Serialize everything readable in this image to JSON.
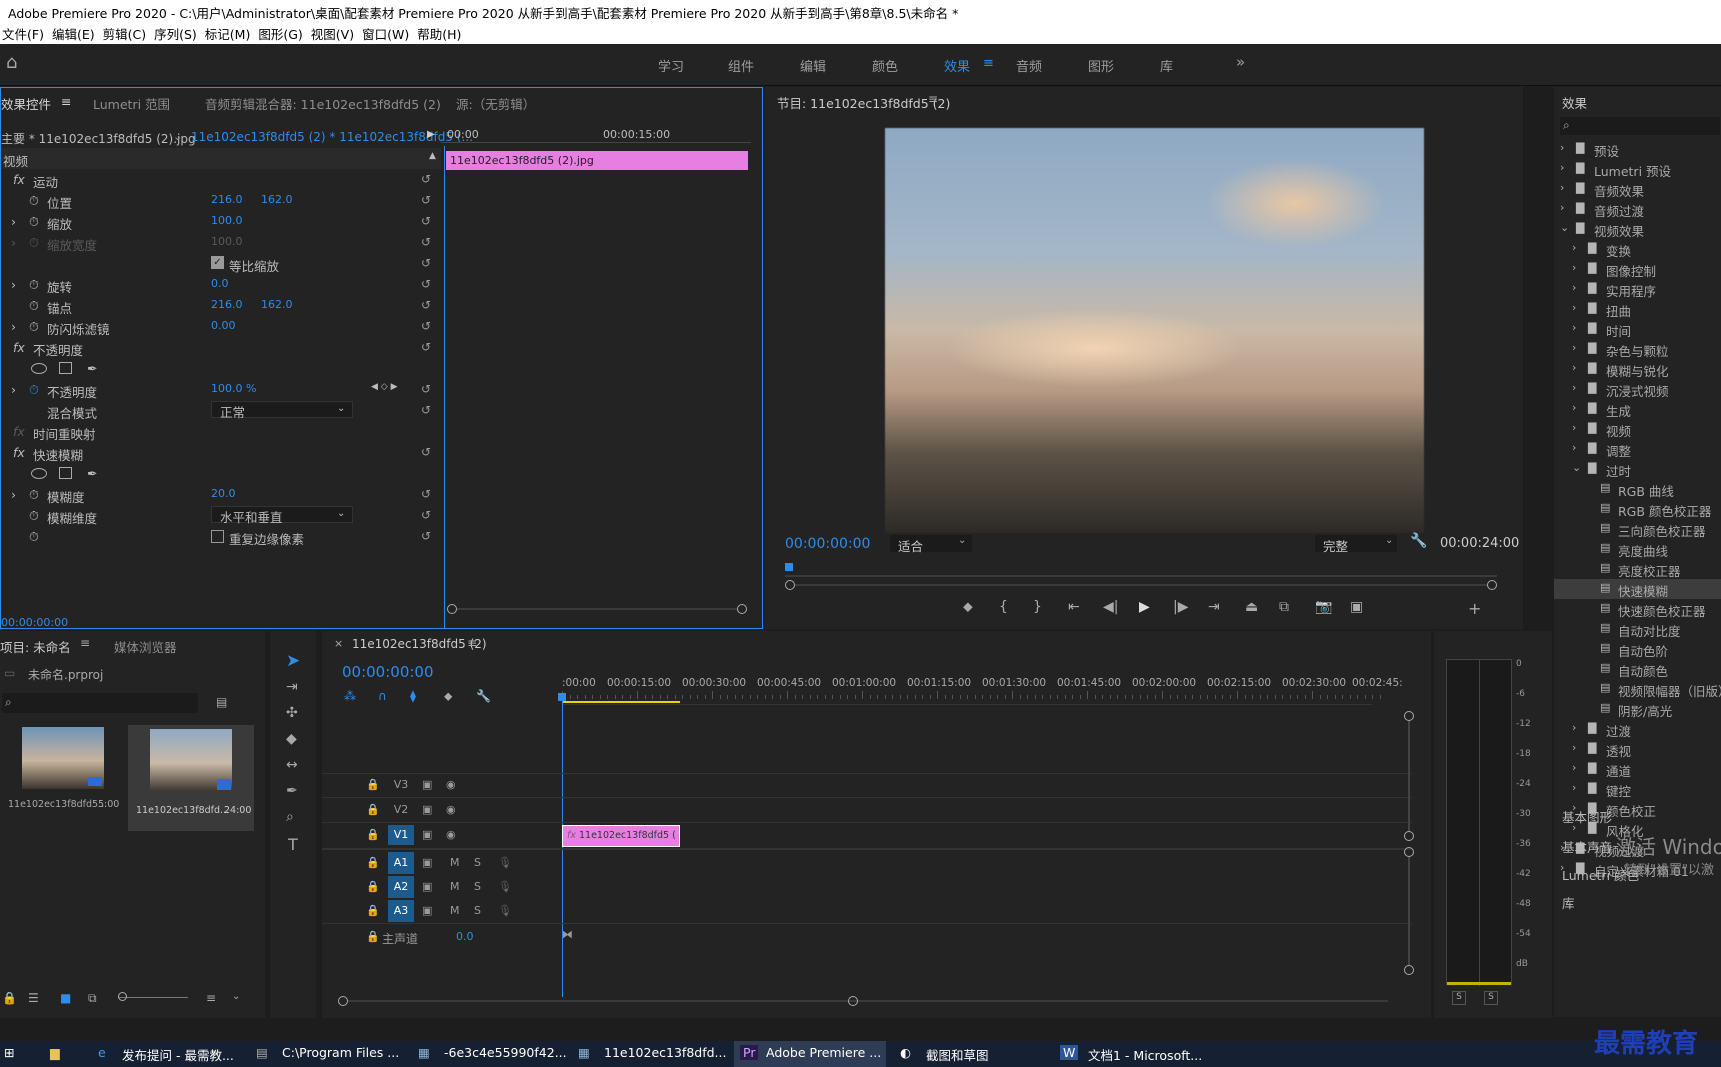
{
  "window": {
    "title": "Adobe Premiere Pro 2020 - C:\\用户\\Administrator\\桌面\\配套素材 Premiere Pro 2020 从新手到高手\\配套素材 Premiere Pro 2020 从新手到高手\\第8章\\8.5\\未命名 *"
  },
  "menu": [
    "文件(F)",
    "编辑(E)",
    "剪辑(C)",
    "序列(S)",
    "标记(M)",
    "图形(G)",
    "视图(V)",
    "窗口(W)",
    "帮助(H)"
  ],
  "workspaces": {
    "items": [
      "学习",
      "组件",
      "编辑",
      "颜色",
      "效果",
      "音频",
      "图形",
      "库"
    ],
    "active": "效果",
    "more": "»"
  },
  "effect_controls": {
    "tabs": [
      "效果控件",
      "Lumetri 范围",
      "音频剪辑混合器: 11e102ec13f8dfd5 (2)",
      "源:（无剪辑）"
    ],
    "master": "主要 * 11e102ec13f8dfd5 (2).jpg",
    "sequence_clip": "11e102ec13f8dfd5 (2) * 11e102ec13f8dfd5 (...",
    "ruler": [
      "00:00",
      "00:00:15:00"
    ],
    "clip_bar": "11e102ec13f8dfd5 (2).jpg",
    "section": "视频",
    "rows": {
      "motion": "运动",
      "position": "位置",
      "pos_x": "216.0",
      "pos_y": "162.0",
      "scale": "缩放",
      "scale_val": "100.0",
      "scale_w": "缩放宽度",
      "scale_w_val": "100.0",
      "uniform": "等比缩放",
      "rotation": "旋转",
      "rotation_val": "0.0",
      "anchor": "锚点",
      "anchor_x": "216.0",
      "anchor_y": "162.0",
      "flicker": "防闪烁滤镜",
      "flicker_val": "0.00",
      "opacity_fx": "不透明度",
      "opacity": "不透明度",
      "opacity_val": "100.0 %",
      "blend": "混合模式",
      "blend_val": "正常",
      "remap": "时间重映射",
      "fast_blur": "快速模糊",
      "blurriness": "模糊度",
      "blurriness_val": "20.0",
      "blur_dim": "模糊维度",
      "blur_dim_val": "水平和垂直",
      "repeat_edge": "重复边缘像素"
    },
    "time": "00:00:00:00"
  },
  "program": {
    "title": "节目: 11e102ec13f8dfd5 (2)",
    "timecode": "00:00:00:00",
    "fit": "适合",
    "quality": "完整",
    "duration": "00:00:24:00"
  },
  "effects_panel": {
    "title": "效果",
    "items": [
      {
        "label": "预设",
        "level": 0
      },
      {
        "label": "Lumetri 预设",
        "level": 0
      },
      {
        "label": "音频效果",
        "level": 0
      },
      {
        "label": "音频过渡",
        "level": 0
      },
      {
        "label": "视频效果",
        "level": 0,
        "open": true
      },
      {
        "label": "变换",
        "level": 1
      },
      {
        "label": "图像控制",
        "level": 1
      },
      {
        "label": "实用程序",
        "level": 1
      },
      {
        "label": "扭曲",
        "level": 1
      },
      {
        "label": "时间",
        "level": 1
      },
      {
        "label": "杂色与颗粒",
        "level": 1
      },
      {
        "label": "模糊与锐化",
        "level": 1
      },
      {
        "label": "沉浸式视频",
        "level": 1
      },
      {
        "label": "生成",
        "level": 1
      },
      {
        "label": "视频",
        "level": 1
      },
      {
        "label": "调整",
        "level": 1
      },
      {
        "label": "过时",
        "level": 1,
        "open": true
      },
      {
        "label": "RGB 曲线",
        "level": 2
      },
      {
        "label": "RGB 颜色校正器",
        "level": 2
      },
      {
        "label": "三向颜色校正器",
        "level": 2
      },
      {
        "label": "亮度曲线",
        "level": 2
      },
      {
        "label": "亮度校正器",
        "level": 2
      },
      {
        "label": "快速模糊",
        "level": 2,
        "selected": true
      },
      {
        "label": "快速颜色校正器",
        "level": 2
      },
      {
        "label": "自动对比度",
        "level": 2
      },
      {
        "label": "自动色阶",
        "level": 2
      },
      {
        "label": "自动颜色",
        "level": 2
      },
      {
        "label": "视频限幅器（旧版）",
        "level": 2
      },
      {
        "label": "阴影/高光",
        "level": 2
      },
      {
        "label": "过渡",
        "level": 1
      },
      {
        "label": "透视",
        "level": 1
      },
      {
        "label": "通道",
        "level": 1
      },
      {
        "label": "键控",
        "level": 1
      },
      {
        "label": "颜色校正",
        "level": 1
      },
      {
        "label": "风格化",
        "level": 1
      },
      {
        "label": "视频过渡",
        "level": 0
      },
      {
        "label": "自定义素材箱 01",
        "level": 0
      }
    ],
    "bottom": [
      "基本图形",
      "基本声音",
      "Lumetri 颜色",
      "库"
    ],
    "watermark": "激活 Windo",
    "watermark2": "转到\"设置\"以激"
  },
  "project": {
    "tabs": [
      "项目: 未命名",
      "媒体浏览器"
    ],
    "file": "未命名.prproj",
    "thumbs": [
      {
        "name": "11e102ec13f8dfd5...",
        "dur": "5:00"
      },
      {
        "name": "11e102ec13f8dfd...",
        "dur": "24:00"
      }
    ]
  },
  "timeline": {
    "tab": "11e102ec13f8dfd5 (2)",
    "timecode": "00:00:00:00",
    "ruler": [
      ":00:00",
      "00:00:15:00",
      "00:00:30:00",
      "00:00:45:00",
      "00:01:00:00",
      "00:01:15:00",
      "00:01:30:00",
      "00:01:45:00",
      "00:02:00:00",
      "00:02:15:00",
      "00:02:30:00",
      "00:02:45:"
    ],
    "video_tracks": [
      "V3",
      "V2",
      "V1"
    ],
    "audio_tracks": [
      "A1",
      "A2",
      "A3"
    ],
    "master": "主声道",
    "master_val": "0.0",
    "clip": "11e102ec13f8dfd5 (",
    "track_m": "M",
    "track_s": "S",
    "fx": "fx"
  },
  "meter": {
    "labels": [
      "0",
      "-6",
      "-12",
      "-18",
      "-24",
      "-30",
      "-36",
      "-42",
      "-48",
      "-54",
      "dB"
    ],
    "solo": [
      "S",
      "S"
    ]
  },
  "taskbar": {
    "items": [
      "发布提问 - 最需教...",
      "C:\\Program Files ...",
      "-6e3c4e55990f42...",
      "11e102ec13f8dfd...",
      "Adobe Premiere ...",
      "截图和草图",
      "文档1 - Microsoft..."
    ],
    "brand": "最需教育"
  }
}
